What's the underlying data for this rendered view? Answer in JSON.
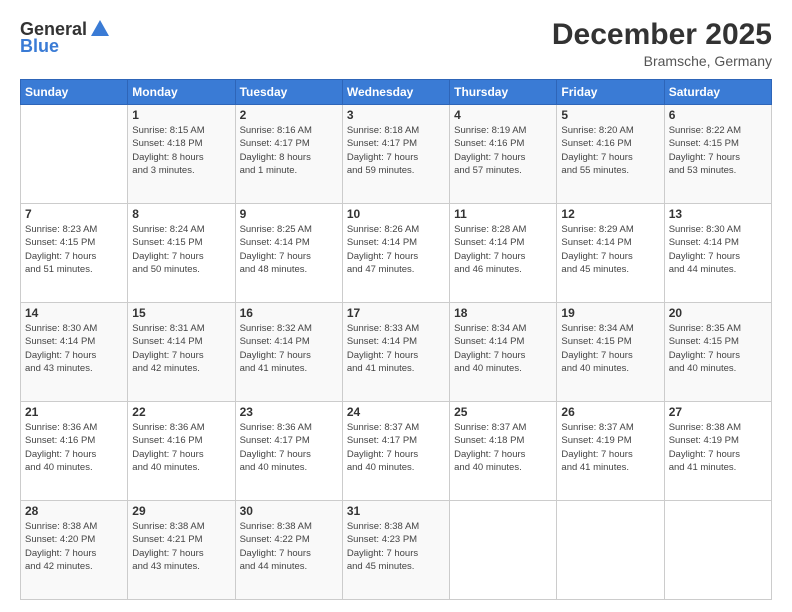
{
  "header": {
    "logo_general": "General",
    "logo_blue": "Blue",
    "month_title": "December 2025",
    "location": "Bramsche, Germany"
  },
  "days_of_week": [
    "Sunday",
    "Monday",
    "Tuesday",
    "Wednesday",
    "Thursday",
    "Friday",
    "Saturday"
  ],
  "weeks": [
    [
      {
        "day": "",
        "info": ""
      },
      {
        "day": "1",
        "info": "Sunrise: 8:15 AM\nSunset: 4:18 PM\nDaylight: 8 hours\nand 3 minutes."
      },
      {
        "day": "2",
        "info": "Sunrise: 8:16 AM\nSunset: 4:17 PM\nDaylight: 8 hours\nand 1 minute."
      },
      {
        "day": "3",
        "info": "Sunrise: 8:18 AM\nSunset: 4:17 PM\nDaylight: 7 hours\nand 59 minutes."
      },
      {
        "day": "4",
        "info": "Sunrise: 8:19 AM\nSunset: 4:16 PM\nDaylight: 7 hours\nand 57 minutes."
      },
      {
        "day": "5",
        "info": "Sunrise: 8:20 AM\nSunset: 4:16 PM\nDaylight: 7 hours\nand 55 minutes."
      },
      {
        "day": "6",
        "info": "Sunrise: 8:22 AM\nSunset: 4:15 PM\nDaylight: 7 hours\nand 53 minutes."
      }
    ],
    [
      {
        "day": "7",
        "info": "Sunrise: 8:23 AM\nSunset: 4:15 PM\nDaylight: 7 hours\nand 51 minutes."
      },
      {
        "day": "8",
        "info": "Sunrise: 8:24 AM\nSunset: 4:15 PM\nDaylight: 7 hours\nand 50 minutes."
      },
      {
        "day": "9",
        "info": "Sunrise: 8:25 AM\nSunset: 4:14 PM\nDaylight: 7 hours\nand 48 minutes."
      },
      {
        "day": "10",
        "info": "Sunrise: 8:26 AM\nSunset: 4:14 PM\nDaylight: 7 hours\nand 47 minutes."
      },
      {
        "day": "11",
        "info": "Sunrise: 8:28 AM\nSunset: 4:14 PM\nDaylight: 7 hours\nand 46 minutes."
      },
      {
        "day": "12",
        "info": "Sunrise: 8:29 AM\nSunset: 4:14 PM\nDaylight: 7 hours\nand 45 minutes."
      },
      {
        "day": "13",
        "info": "Sunrise: 8:30 AM\nSunset: 4:14 PM\nDaylight: 7 hours\nand 44 minutes."
      }
    ],
    [
      {
        "day": "14",
        "info": "Sunrise: 8:30 AM\nSunset: 4:14 PM\nDaylight: 7 hours\nand 43 minutes."
      },
      {
        "day": "15",
        "info": "Sunrise: 8:31 AM\nSunset: 4:14 PM\nDaylight: 7 hours\nand 42 minutes."
      },
      {
        "day": "16",
        "info": "Sunrise: 8:32 AM\nSunset: 4:14 PM\nDaylight: 7 hours\nand 41 minutes."
      },
      {
        "day": "17",
        "info": "Sunrise: 8:33 AM\nSunset: 4:14 PM\nDaylight: 7 hours\nand 41 minutes."
      },
      {
        "day": "18",
        "info": "Sunrise: 8:34 AM\nSunset: 4:14 PM\nDaylight: 7 hours\nand 40 minutes."
      },
      {
        "day": "19",
        "info": "Sunrise: 8:34 AM\nSunset: 4:15 PM\nDaylight: 7 hours\nand 40 minutes."
      },
      {
        "day": "20",
        "info": "Sunrise: 8:35 AM\nSunset: 4:15 PM\nDaylight: 7 hours\nand 40 minutes."
      }
    ],
    [
      {
        "day": "21",
        "info": "Sunrise: 8:36 AM\nSunset: 4:16 PM\nDaylight: 7 hours\nand 40 minutes."
      },
      {
        "day": "22",
        "info": "Sunrise: 8:36 AM\nSunset: 4:16 PM\nDaylight: 7 hours\nand 40 minutes."
      },
      {
        "day": "23",
        "info": "Sunrise: 8:36 AM\nSunset: 4:17 PM\nDaylight: 7 hours\nand 40 minutes."
      },
      {
        "day": "24",
        "info": "Sunrise: 8:37 AM\nSunset: 4:17 PM\nDaylight: 7 hours\nand 40 minutes."
      },
      {
        "day": "25",
        "info": "Sunrise: 8:37 AM\nSunset: 4:18 PM\nDaylight: 7 hours\nand 40 minutes."
      },
      {
        "day": "26",
        "info": "Sunrise: 8:37 AM\nSunset: 4:19 PM\nDaylight: 7 hours\nand 41 minutes."
      },
      {
        "day": "27",
        "info": "Sunrise: 8:38 AM\nSunset: 4:19 PM\nDaylight: 7 hours\nand 41 minutes."
      }
    ],
    [
      {
        "day": "28",
        "info": "Sunrise: 8:38 AM\nSunset: 4:20 PM\nDaylight: 7 hours\nand 42 minutes."
      },
      {
        "day": "29",
        "info": "Sunrise: 8:38 AM\nSunset: 4:21 PM\nDaylight: 7 hours\nand 43 minutes."
      },
      {
        "day": "30",
        "info": "Sunrise: 8:38 AM\nSunset: 4:22 PM\nDaylight: 7 hours\nand 44 minutes."
      },
      {
        "day": "31",
        "info": "Sunrise: 8:38 AM\nSunset: 4:23 PM\nDaylight: 7 hours\nand 45 minutes."
      },
      {
        "day": "",
        "info": ""
      },
      {
        "day": "",
        "info": ""
      },
      {
        "day": "",
        "info": ""
      }
    ]
  ]
}
